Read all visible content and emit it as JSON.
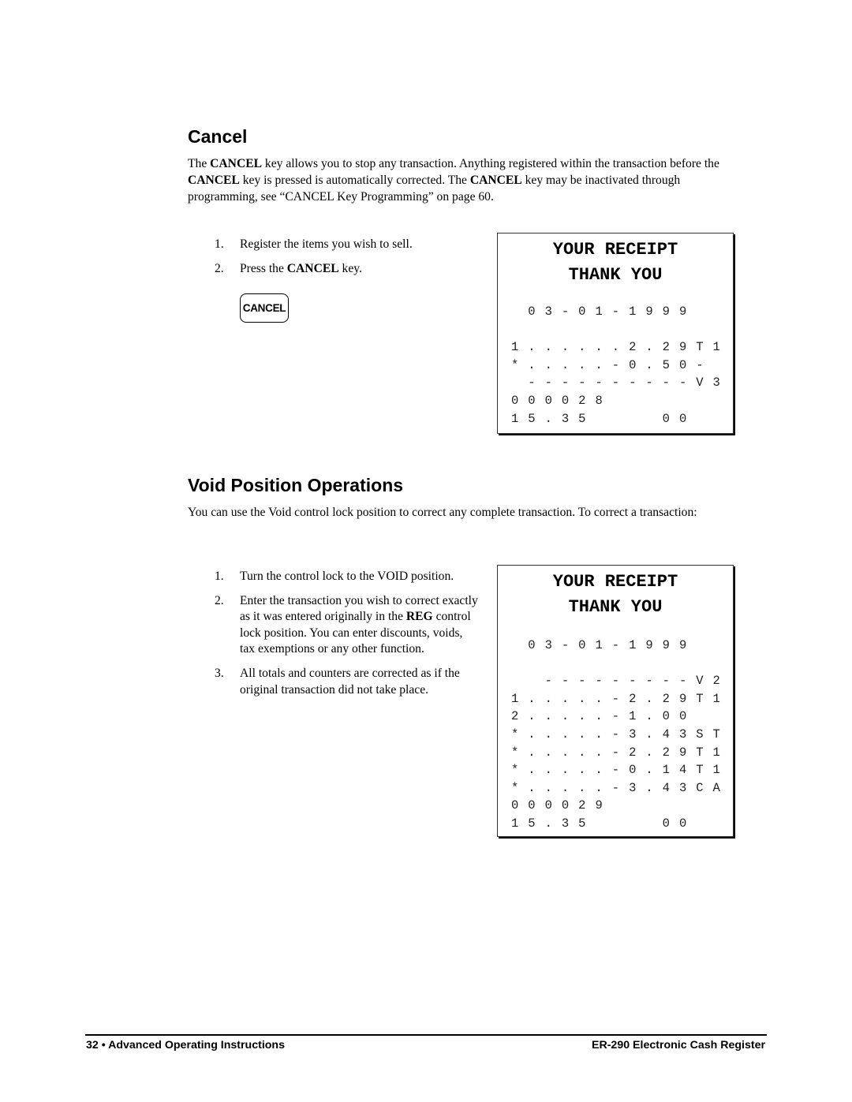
{
  "cancel_section": {
    "heading": "Cancel",
    "paragraph": [
      {
        "t": "The "
      },
      {
        "b": "CANCEL"
      },
      {
        "t": " key allows you to stop any transaction.  Anything registered within the transaction before the "
      },
      {
        "b": "CANCEL"
      },
      {
        "t": " key is pressed is automatically corrected.  The "
      },
      {
        "b": "CANCEL"
      },
      {
        "t": " key may be inactivated through programming, see “CANCEL Key Programming” on page 60."
      }
    ],
    "steps": [
      {
        "num": "1.",
        "parts": [
          {
            "t": "Register the items you wish to sell."
          }
        ]
      },
      {
        "num": "2.",
        "parts": [
          {
            "t": "Press the "
          },
          {
            "b": "CANCEL"
          },
          {
            "t": " key."
          }
        ]
      }
    ],
    "key_label": "CANCEL",
    "receipt": {
      "title_line1": "YOUR RECEIPT",
      "title_line2": "THANK YOU",
      "lines": [
        " 03-01-1999  ",
        "",
        "1......2.29T1",
        "*.....-0.50- ",
        " ----------V3",
        "000028       ",
        "15.35    00  "
      ]
    }
  },
  "void_section": {
    "heading": "Void Position Operations",
    "paragraph": [
      {
        "t": "You can use the Void control lock position to correct any complete transaction.  To correct a transaction:"
      }
    ],
    "steps": [
      {
        "num": "1.",
        "parts": [
          {
            "t": "Turn the control lock to the VOID position."
          }
        ]
      },
      {
        "num": "2.",
        "parts": [
          {
            "t": "Enter the transaction you wish to correct exactly as it was entered originally in the "
          },
          {
            "b": "REG"
          },
          {
            "t": " control lock position.  You can enter discounts, voids, tax exemptions or any other function."
          }
        ]
      },
      {
        "num": "3.",
        "parts": [
          {
            "t": "All totals and counters are corrected as if the original transaction did not take place."
          }
        ]
      }
    ],
    "receipt": {
      "title_line1": "YOUR RECEIPT",
      "title_line2": "THANK YOU",
      "lines": [
        " 03-01-1999  ",
        "",
        "  ---------V2",
        "1.....-2.29T1",
        "2.....-1.00  ",
        "*.....-3.43ST",
        "*.....-2.29T1",
        "*.....-0.14T1",
        "*.....-3.43CA",
        "000029       ",
        "15.35    00  "
      ]
    }
  },
  "footer": {
    "left": "32 • Advanced Operating Instructions",
    "right": "ER-290 Electronic Cash Register"
  }
}
